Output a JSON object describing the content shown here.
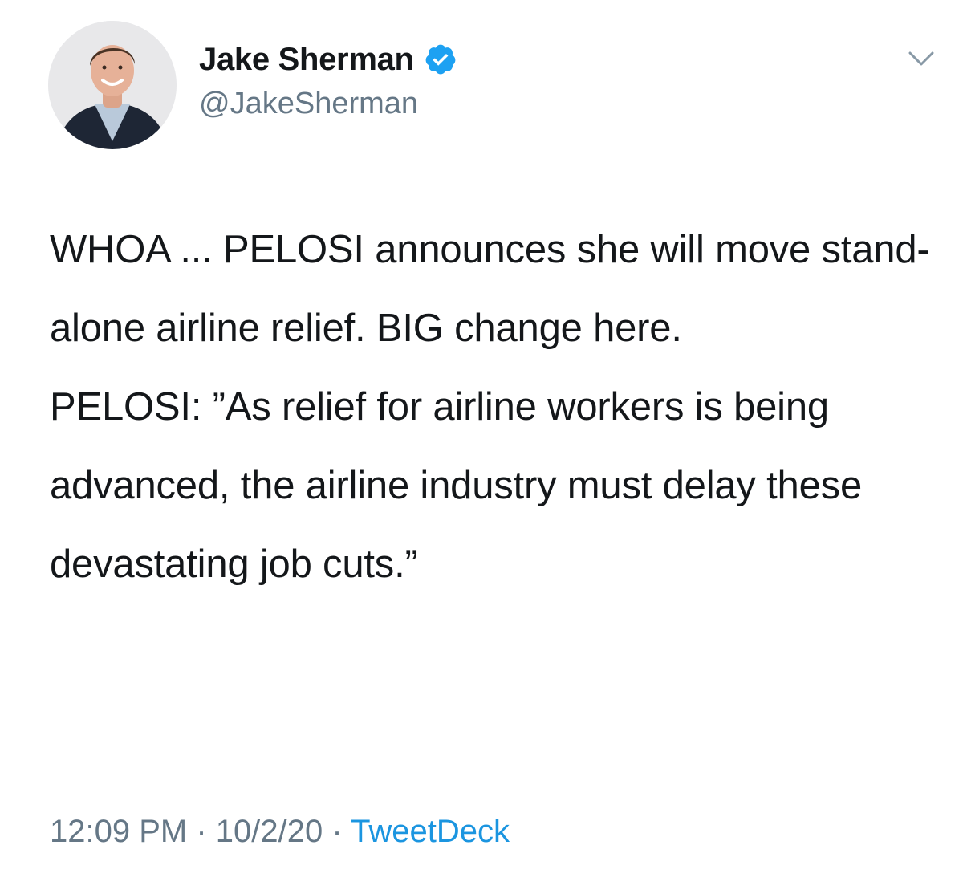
{
  "author": {
    "display_name": "Jake Sherman",
    "handle": "@JakeSherman",
    "verified": true
  },
  "tweet": {
    "paragraphs": [
      "WHOA ... PELOSI announces she will move stand-alone airline relief. BIG change here.",
      "PELOSI: ”As relief for airline workers is being advanced, the airline industry must delay these devastating job cuts.”"
    ]
  },
  "meta": {
    "time": "12:09 PM",
    "separator": "·",
    "date": "10/2/20",
    "source": "TweetDeck"
  },
  "icons": {
    "verified": "verified-badge-icon",
    "more": "chevron-down-icon"
  },
  "colors": {
    "text": "#14171a",
    "secondary": "#657786",
    "link": "#1b95e0",
    "verified": "#1da1f2"
  }
}
